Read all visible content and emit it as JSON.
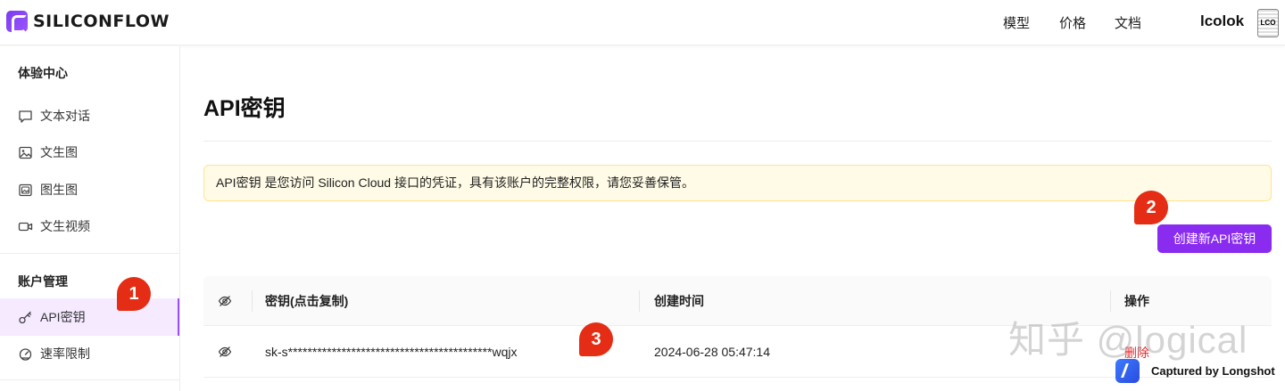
{
  "header": {
    "brand": "SILICONFLOW",
    "nav": [
      "模型",
      "价格",
      "文档"
    ],
    "username": "lcolok",
    "avatar_text": "LCO"
  },
  "sidebar": {
    "section1": "体验中心",
    "items1": [
      {
        "label": "文本对话",
        "icon": "chat-icon"
      },
      {
        "label": "文生图",
        "icon": "image-icon"
      },
      {
        "label": "图生图",
        "icon": "image-stack-icon"
      },
      {
        "label": "文生视频",
        "icon": "video-icon"
      }
    ],
    "section2": "账户管理",
    "items2": [
      {
        "label": "API密钥",
        "icon": "key-icon",
        "active": true
      },
      {
        "label": "速率限制",
        "icon": "gauge-icon"
      }
    ]
  },
  "main": {
    "title": "API密钥",
    "notice": "API密钥 是您访问 Silicon Cloud 接口的凭证，具有该账户的完整权限，请您妥善保管。",
    "create_button": "创建新API密钥",
    "table": {
      "headers": [
        "密钥(点击复制)",
        "创建时间",
        "操作"
      ],
      "rows": [
        {
          "key": "sk-s******************************************wqjx",
          "created": "2024-06-28 05:47:14",
          "action": "删除"
        }
      ]
    }
  },
  "annotations": [
    "1",
    "2",
    "3"
  ],
  "watermark": "知乎 @logical",
  "capture_label": "Captured by Longshot",
  "colors": {
    "accent": "#8a2bf0",
    "badge": "#e42d14",
    "notice_bg": "#fffbe6",
    "delete": "#e8262a"
  }
}
